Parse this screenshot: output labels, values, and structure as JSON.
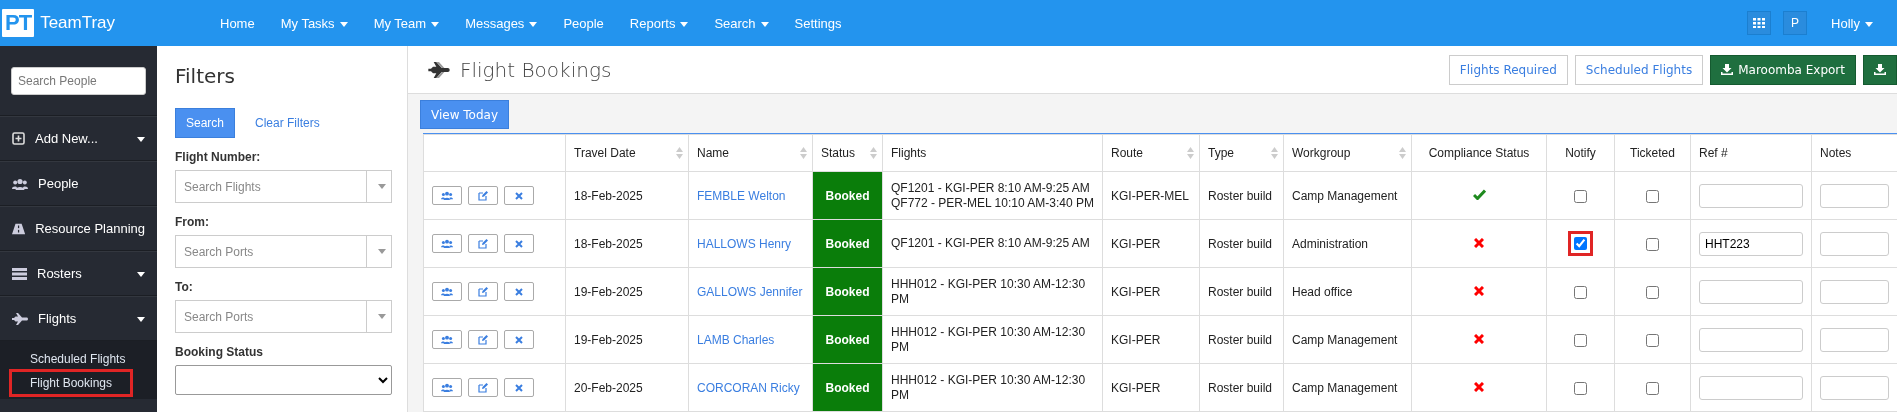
{
  "navbar": {
    "logo": {
      "mark": "PT",
      "name": "TeamTray"
    },
    "menu": [
      {
        "label": "Home",
        "dropdown": false
      },
      {
        "label": "My Tasks",
        "dropdown": true
      },
      {
        "label": "My Team",
        "dropdown": true
      },
      {
        "label": "Messages",
        "dropdown": true
      },
      {
        "label": "People",
        "dropdown": false
      },
      {
        "label": "Reports",
        "dropdown": true
      },
      {
        "label": "Search",
        "dropdown": true
      },
      {
        "label": "Settings",
        "dropdown": false
      }
    ],
    "user_initial": "P",
    "user": "Holly"
  },
  "sidebar": {
    "search": {
      "placeholder": "Search People"
    },
    "items": [
      {
        "label": "Add New...",
        "kind": "add",
        "dropdown": true
      },
      {
        "label": "People",
        "kind": "people",
        "dropdown": false
      },
      {
        "label": "Resource Planning",
        "kind": "resource",
        "dropdown": false
      },
      {
        "label": "Rosters",
        "kind": "rosters",
        "dropdown": true
      },
      {
        "label": "Flights",
        "kind": "flights",
        "dropdown": true
      }
    ],
    "subitems": [
      {
        "label": "Scheduled Flights",
        "highlighted": false
      },
      {
        "label": "Flight Bookings",
        "highlighted": true
      }
    ]
  },
  "filters": {
    "title": "Filters",
    "search_button": "Search",
    "clear_link": "Clear Filters",
    "fields": [
      {
        "label": "Flight Number:",
        "kind": "combo",
        "placeholder": "Search Flights"
      },
      {
        "label": "From:",
        "kind": "combo",
        "placeholder": "Search Ports"
      },
      {
        "label": "To:",
        "kind": "combo",
        "placeholder": "Search Ports"
      },
      {
        "label": "Booking Status",
        "kind": "select"
      }
    ]
  },
  "page": {
    "title": "Flight Bookings",
    "actions": [
      {
        "label": "Flights Required",
        "kind": "outline"
      },
      {
        "label": "Scheduled Flights",
        "kind": "outline"
      },
      {
        "label": "Maroomba Export",
        "kind": "export"
      },
      {
        "kind": "export"
      }
    ],
    "view_today": "View Today"
  },
  "table": {
    "columns": [
      {
        "label": "Travel Date",
        "sortable": true
      },
      {
        "label": "Name",
        "sortable": true
      },
      {
        "label": "Status",
        "sortable": true
      },
      {
        "label": "Flights",
        "sortable": false
      },
      {
        "label": "Route",
        "sortable": true
      },
      {
        "label": "Type",
        "sortable": true
      },
      {
        "label": "Workgroup",
        "sortable": true
      },
      {
        "label": "Compliance Status",
        "sortable": false
      },
      {
        "label": "Notify",
        "sortable": false
      },
      {
        "label": "Ticketed",
        "sortable": false
      },
      {
        "label": "Ref #",
        "sortable": false
      },
      {
        "label": "Notes",
        "sortable": false
      }
    ],
    "rows": [
      {
        "travel_date": "18-Feb-2025",
        "name": "FEMBLE Welton",
        "status": "Booked",
        "flights": [
          "QF1201 - KGI-PER 8:10 AM-9:25 AM",
          "QF772 - PER-MEL 10:10 AM-3:40 PM"
        ],
        "route": "KGI-PER-MEL",
        "type": "Roster build",
        "workgroup": "Camp Management",
        "compliant": true,
        "notify": false,
        "notify_highlighted": false,
        "ticketed": false
      },
      {
        "travel_date": "18-Feb-2025",
        "name": "HALLOWS Henry",
        "status": "Booked",
        "flights": [
          "QF1201 - KGI-PER 8:10 AM-9:25 AM"
        ],
        "route": "KGI-PER",
        "type": "Roster build",
        "workgroup": "Administration",
        "compliant": false,
        "notify": true,
        "notify_highlighted": true,
        "ticketed": false,
        "ref": "HHT223"
      },
      {
        "travel_date": "19-Feb-2025",
        "name": "GALLOWS Jennifer",
        "status": "Booked",
        "flights": [
          "HHH012 - KGI-PER 10:30 AM-12:30 PM"
        ],
        "route": "KGI-PER",
        "type": "Roster build",
        "workgroup": "Head office",
        "compliant": false,
        "notify": false,
        "notify_highlighted": false,
        "ticketed": false
      },
      {
        "travel_date": "19-Feb-2025",
        "name": "LAMB Charles",
        "status": "Booked",
        "flights": [
          "HHH012 - KGI-PER 10:30 AM-12:30 PM"
        ],
        "route": "KGI-PER",
        "type": "Roster build",
        "workgroup": "Camp Management",
        "compliant": false,
        "notify": false,
        "notify_highlighted": false,
        "ticketed": false
      },
      {
        "travel_date": "20-Feb-2025",
        "name": "CORCORAN Ricky",
        "status": "Booked",
        "flights": [
          "HHH012 - KGI-PER 10:30 AM-12:30 PM"
        ],
        "route": "KGI-PER",
        "type": "Roster build",
        "workgroup": "Camp Management",
        "compliant": false,
        "notify": false,
        "notify_highlighted": false,
        "ticketed": false
      }
    ]
  }
}
